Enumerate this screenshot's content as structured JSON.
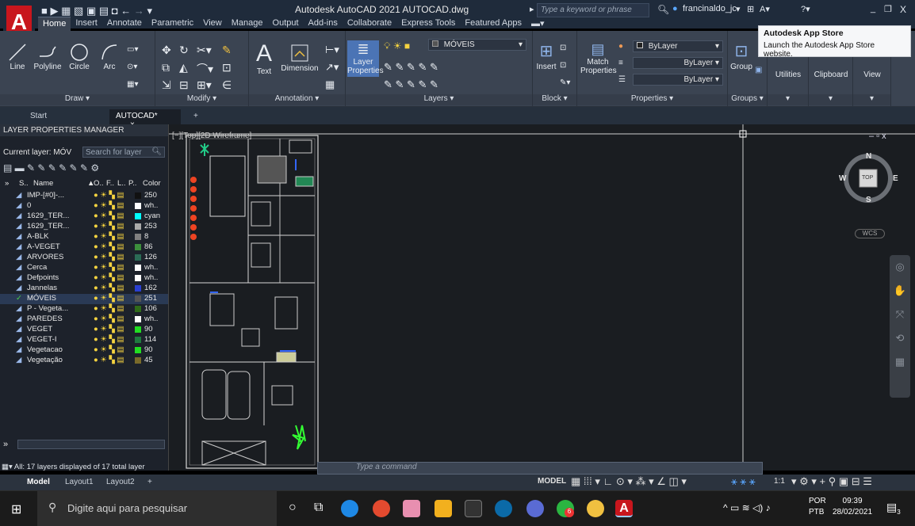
{
  "window": {
    "title": "Autodesk AutoCAD 2021   AUTOCAD.dwg",
    "search_placeholder": "Type a keyword or phrase",
    "user": "francinaldo_jc",
    "min": "_",
    "max": "❐",
    "close": "X"
  },
  "tooltip": {
    "title": "Autodesk App Store",
    "text": "Launch the Autodesk App Store website."
  },
  "ribbon_tabs": [
    "Home",
    "Insert",
    "Annotate",
    "Parametric",
    "View",
    "Manage",
    "Output",
    "Add-ins",
    "Collaborate",
    "Express Tools",
    "Featured Apps"
  ],
  "ribbon": {
    "draw": {
      "title": "Draw ▾",
      "line": "Line",
      "polyline": "Polyline",
      "circle": "Circle",
      "arc": "Arc"
    },
    "modify": {
      "title": "Modify ▾"
    },
    "annotation": {
      "title": "Annotation ▾",
      "text": "Text",
      "dimension": "Dimension"
    },
    "layers": {
      "title": "Layers ▾",
      "layer_properties_1": "Layer",
      "layer_properties_2": "Properties",
      "current_layer": "MÓVEIS"
    },
    "block": {
      "title": "Block ▾",
      "insert": "Insert"
    },
    "properties": {
      "title": "Properties ▾",
      "match_1": "Match",
      "match_2": "Properties",
      "color": "ByLayer",
      "linetype": "ByLayer",
      "lineweight": "ByLayer"
    },
    "groups": {
      "title": "Groups ▾",
      "group": "Group"
    },
    "utilities": "Utilities",
    "clipboard": "Clipboard",
    "view": "View"
  },
  "doc_tabs": {
    "start": "Start",
    "active": "AUTOCAD*",
    "close": "×",
    "add": "+"
  },
  "layer_manager": {
    "title": "LAYER PROPERTIES MANAGER",
    "current": "Current layer: MÓV",
    "search_placeholder": "Search for layer",
    "columns": {
      "s": "S..",
      "name": "Name",
      "o": "O..",
      "f": "F..",
      "l": "L..",
      "p": "P..",
      "color": "Color"
    },
    "layers": [
      {
        "name": "IMP-[#0]-...",
        "color": "250",
        "swatch": "#111111",
        "current": false
      },
      {
        "name": "0",
        "color": "wh..",
        "swatch": "#ffffff",
        "current": false
      },
      {
        "name": "1629_TER...",
        "color": "cyan",
        "swatch": "#00ffff",
        "current": false
      },
      {
        "name": "1629_TER...",
        "color": "253",
        "swatch": "#aaaaaa",
        "current": false
      },
      {
        "name": "A-BLK",
        "color": "8",
        "swatch": "#808080",
        "current": false
      },
      {
        "name": "A-VEGET",
        "color": "86",
        "swatch": "#3c8f3c",
        "current": false
      },
      {
        "name": "ARVORES",
        "color": "126",
        "swatch": "#2b6b55",
        "current": false
      },
      {
        "name": "Cerca",
        "color": "wh..",
        "swatch": "#ffffff",
        "current": false
      },
      {
        "name": "Defpoints",
        "color": "wh..",
        "swatch": "#ffffff",
        "current": false
      },
      {
        "name": "Jannelas",
        "color": "162",
        "swatch": "#2a3fd1",
        "current": false
      },
      {
        "name": "MÓVEIS",
        "color": "251",
        "swatch": "#555555",
        "current": true
      },
      {
        "name": "P - Vegeta...",
        "color": "106",
        "swatch": "#2f6b1a",
        "current": false
      },
      {
        "name": "PAREDES",
        "color": "wh..",
        "swatch": "#ffffff",
        "current": false
      },
      {
        "name": "VEGET",
        "color": "90",
        "swatch": "#22dd22",
        "current": false
      },
      {
        "name": "VEGET-I",
        "color": "114",
        "swatch": "#1f7a3f",
        "current": false
      },
      {
        "name": "Vegetacao",
        "color": "90",
        "swatch": "#22dd22",
        "current": false
      },
      {
        "name": "Vegetação",
        "color": "45",
        "swatch": "#7a6a2a",
        "current": false
      }
    ],
    "footer": "All: 17 layers displayed of 17 total layer"
  },
  "viewport": {
    "label": "[−][Top][2D Wireframe]",
    "compass": {
      "n": "N",
      "s": "S",
      "e": "E",
      "w": "W",
      "top": "TOP"
    },
    "wcs": "WCS"
  },
  "command": {
    "placeholder": "Type a command"
  },
  "layout_tabs": [
    "Model",
    "Layout1",
    "Layout2",
    "+"
  ],
  "status": {
    "model": "MODEL",
    "scale": "1:1"
  },
  "taskbar": {
    "search": "Digite aqui para pesquisar",
    "lang1": "POR",
    "lang2": "PTB",
    "time": "09:39",
    "date": "28/02/2021",
    "notif": "3",
    "badge": "6"
  }
}
